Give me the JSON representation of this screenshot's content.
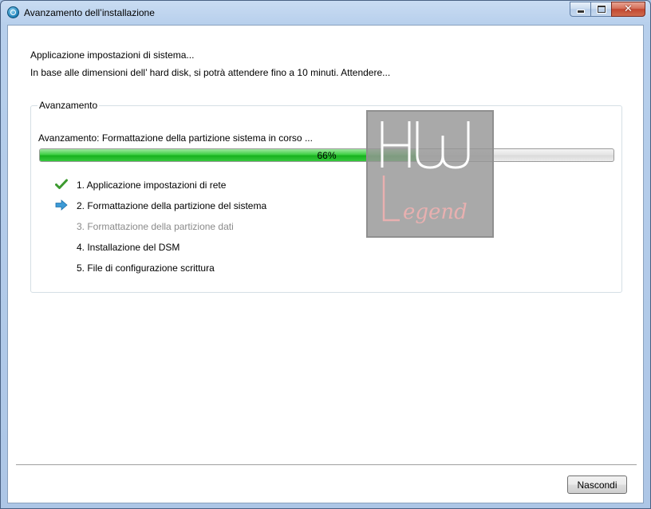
{
  "window": {
    "title": "Avanzamento dell’installazione"
  },
  "message": {
    "line1": "Applicazione impostazioni di sistema...",
    "line2": "In base alle dimensioni dell’ hard disk, si potrà attendere fino a 10 minuti. Attendere..."
  },
  "progress_group": {
    "legend": "Avanzamento",
    "status": "Avanzamento: Formattazione della partizione sistema in corso ...",
    "percent_text": "66%",
    "percent_value": 66,
    "fill_color": "#2fc437"
  },
  "steps": [
    {
      "label": "1. Applicazione impostazioni di rete",
      "state": "done",
      "icon": "checkmark-icon"
    },
    {
      "label": "2. Formattazione della partizione del sistema",
      "state": "current",
      "icon": "arrow-right-icon"
    },
    {
      "label": "3. Formattazione della partizione dati",
      "state": "pending",
      "icon": ""
    },
    {
      "label": "4. Installazione del DSM",
      "state": "pending-active",
      "icon": ""
    },
    {
      "label": "5. File di configurazione scrittura",
      "state": "pending-active",
      "icon": ""
    }
  ],
  "watermark": {
    "logo": "HW Legend"
  },
  "footer": {
    "hide_button_label": "Nascondi"
  },
  "colors": {
    "check_green": "#3c9a2f",
    "arrow_blue": "#3c9ad6",
    "titlebar": "#b7cfec"
  }
}
